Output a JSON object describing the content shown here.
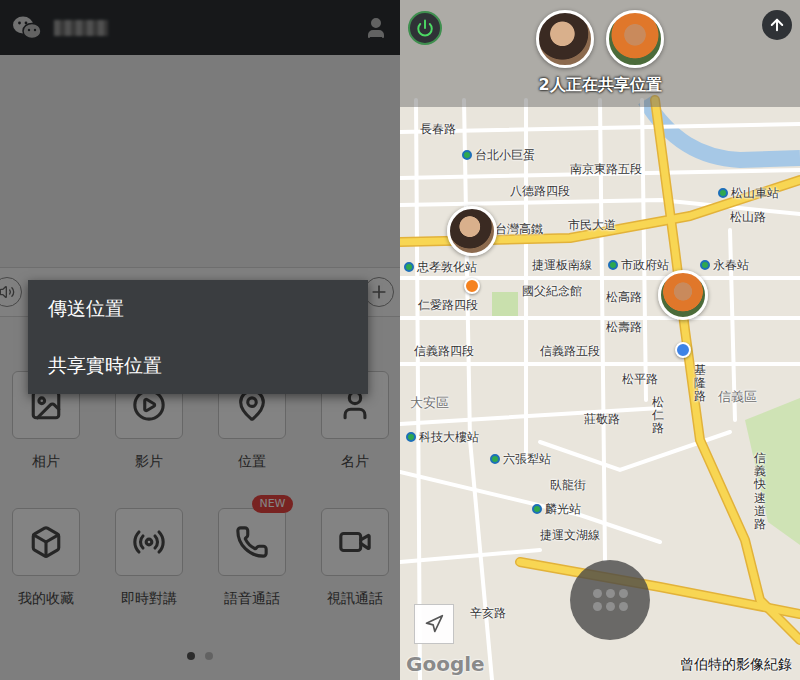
{
  "menu": {
    "items": [
      {
        "label": "傳送位置"
      },
      {
        "label": "共享實時位置"
      }
    ]
  },
  "attachments": [
    {
      "label": "相片",
      "badge": ""
    },
    {
      "label": "影片",
      "badge": ""
    },
    {
      "label": "位置",
      "badge": ""
    },
    {
      "label": "名片",
      "badge": ""
    },
    {
      "label": "我的收藏",
      "badge": ""
    },
    {
      "label": "即時對講",
      "badge": ""
    },
    {
      "label": "語音通話",
      "badge": "NEW"
    },
    {
      "label": "視訊通話",
      "badge": ""
    }
  ],
  "pages": [
    {
      "selected": true
    },
    {
      "selected": false
    }
  ],
  "share": {
    "status": "2人正在共享位置",
    "participants": [
      {
        "color": "#f5821f"
      },
      {
        "color": "#3d83e6"
      }
    ]
  },
  "map": {
    "labels": [
      {
        "text": "長春路",
        "kind": "road"
      },
      {
        "text": "台北小巨蛋",
        "kind": "station"
      },
      {
        "text": "南京東路五段",
        "kind": "road"
      },
      {
        "text": "八德路四段",
        "kind": "road"
      },
      {
        "text": "松山車站",
        "kind": "station"
      },
      {
        "text": "松山路",
        "kind": "road"
      },
      {
        "text": "台灣高鐵",
        "kind": "road"
      },
      {
        "text": "市民大道",
        "kind": "road"
      },
      {
        "text": "忠孝敦化站",
        "kind": "station"
      },
      {
        "text": "捷運板南線",
        "kind": "road"
      },
      {
        "text": "市政府站",
        "kind": "station"
      },
      {
        "text": "永春站",
        "kind": "station"
      },
      {
        "text": "國父紀念館",
        "kind": "road"
      },
      {
        "text": "仁愛路四段",
        "kind": "road"
      },
      {
        "text": "松高路",
        "kind": "road"
      },
      {
        "text": "松壽路",
        "kind": "road"
      },
      {
        "text": "信義路四段",
        "kind": "road"
      },
      {
        "text": "信義路五段",
        "kind": "road"
      },
      {
        "text": "松平路",
        "kind": "road"
      },
      {
        "text": "基隆路",
        "kind": "vroad"
      },
      {
        "text": "松仁路",
        "kind": "vroad"
      },
      {
        "text": "信義區",
        "kind": "area"
      },
      {
        "text": "大安區",
        "kind": "area"
      },
      {
        "text": "莊敬路",
        "kind": "road"
      },
      {
        "text": "科技大樓站",
        "kind": "station"
      },
      {
        "text": "六張犁站",
        "kind": "station"
      },
      {
        "text": "臥龍街",
        "kind": "road"
      },
      {
        "text": "麟光站",
        "kind": "station"
      },
      {
        "text": "捷運文湖線",
        "kind": "road"
      },
      {
        "text": "信義快速道路",
        "kind": "vroad"
      },
      {
        "text": "辛亥路",
        "kind": "road"
      }
    ],
    "attribution": "Google"
  },
  "watermark": "曾伯特的影像紀錄"
}
